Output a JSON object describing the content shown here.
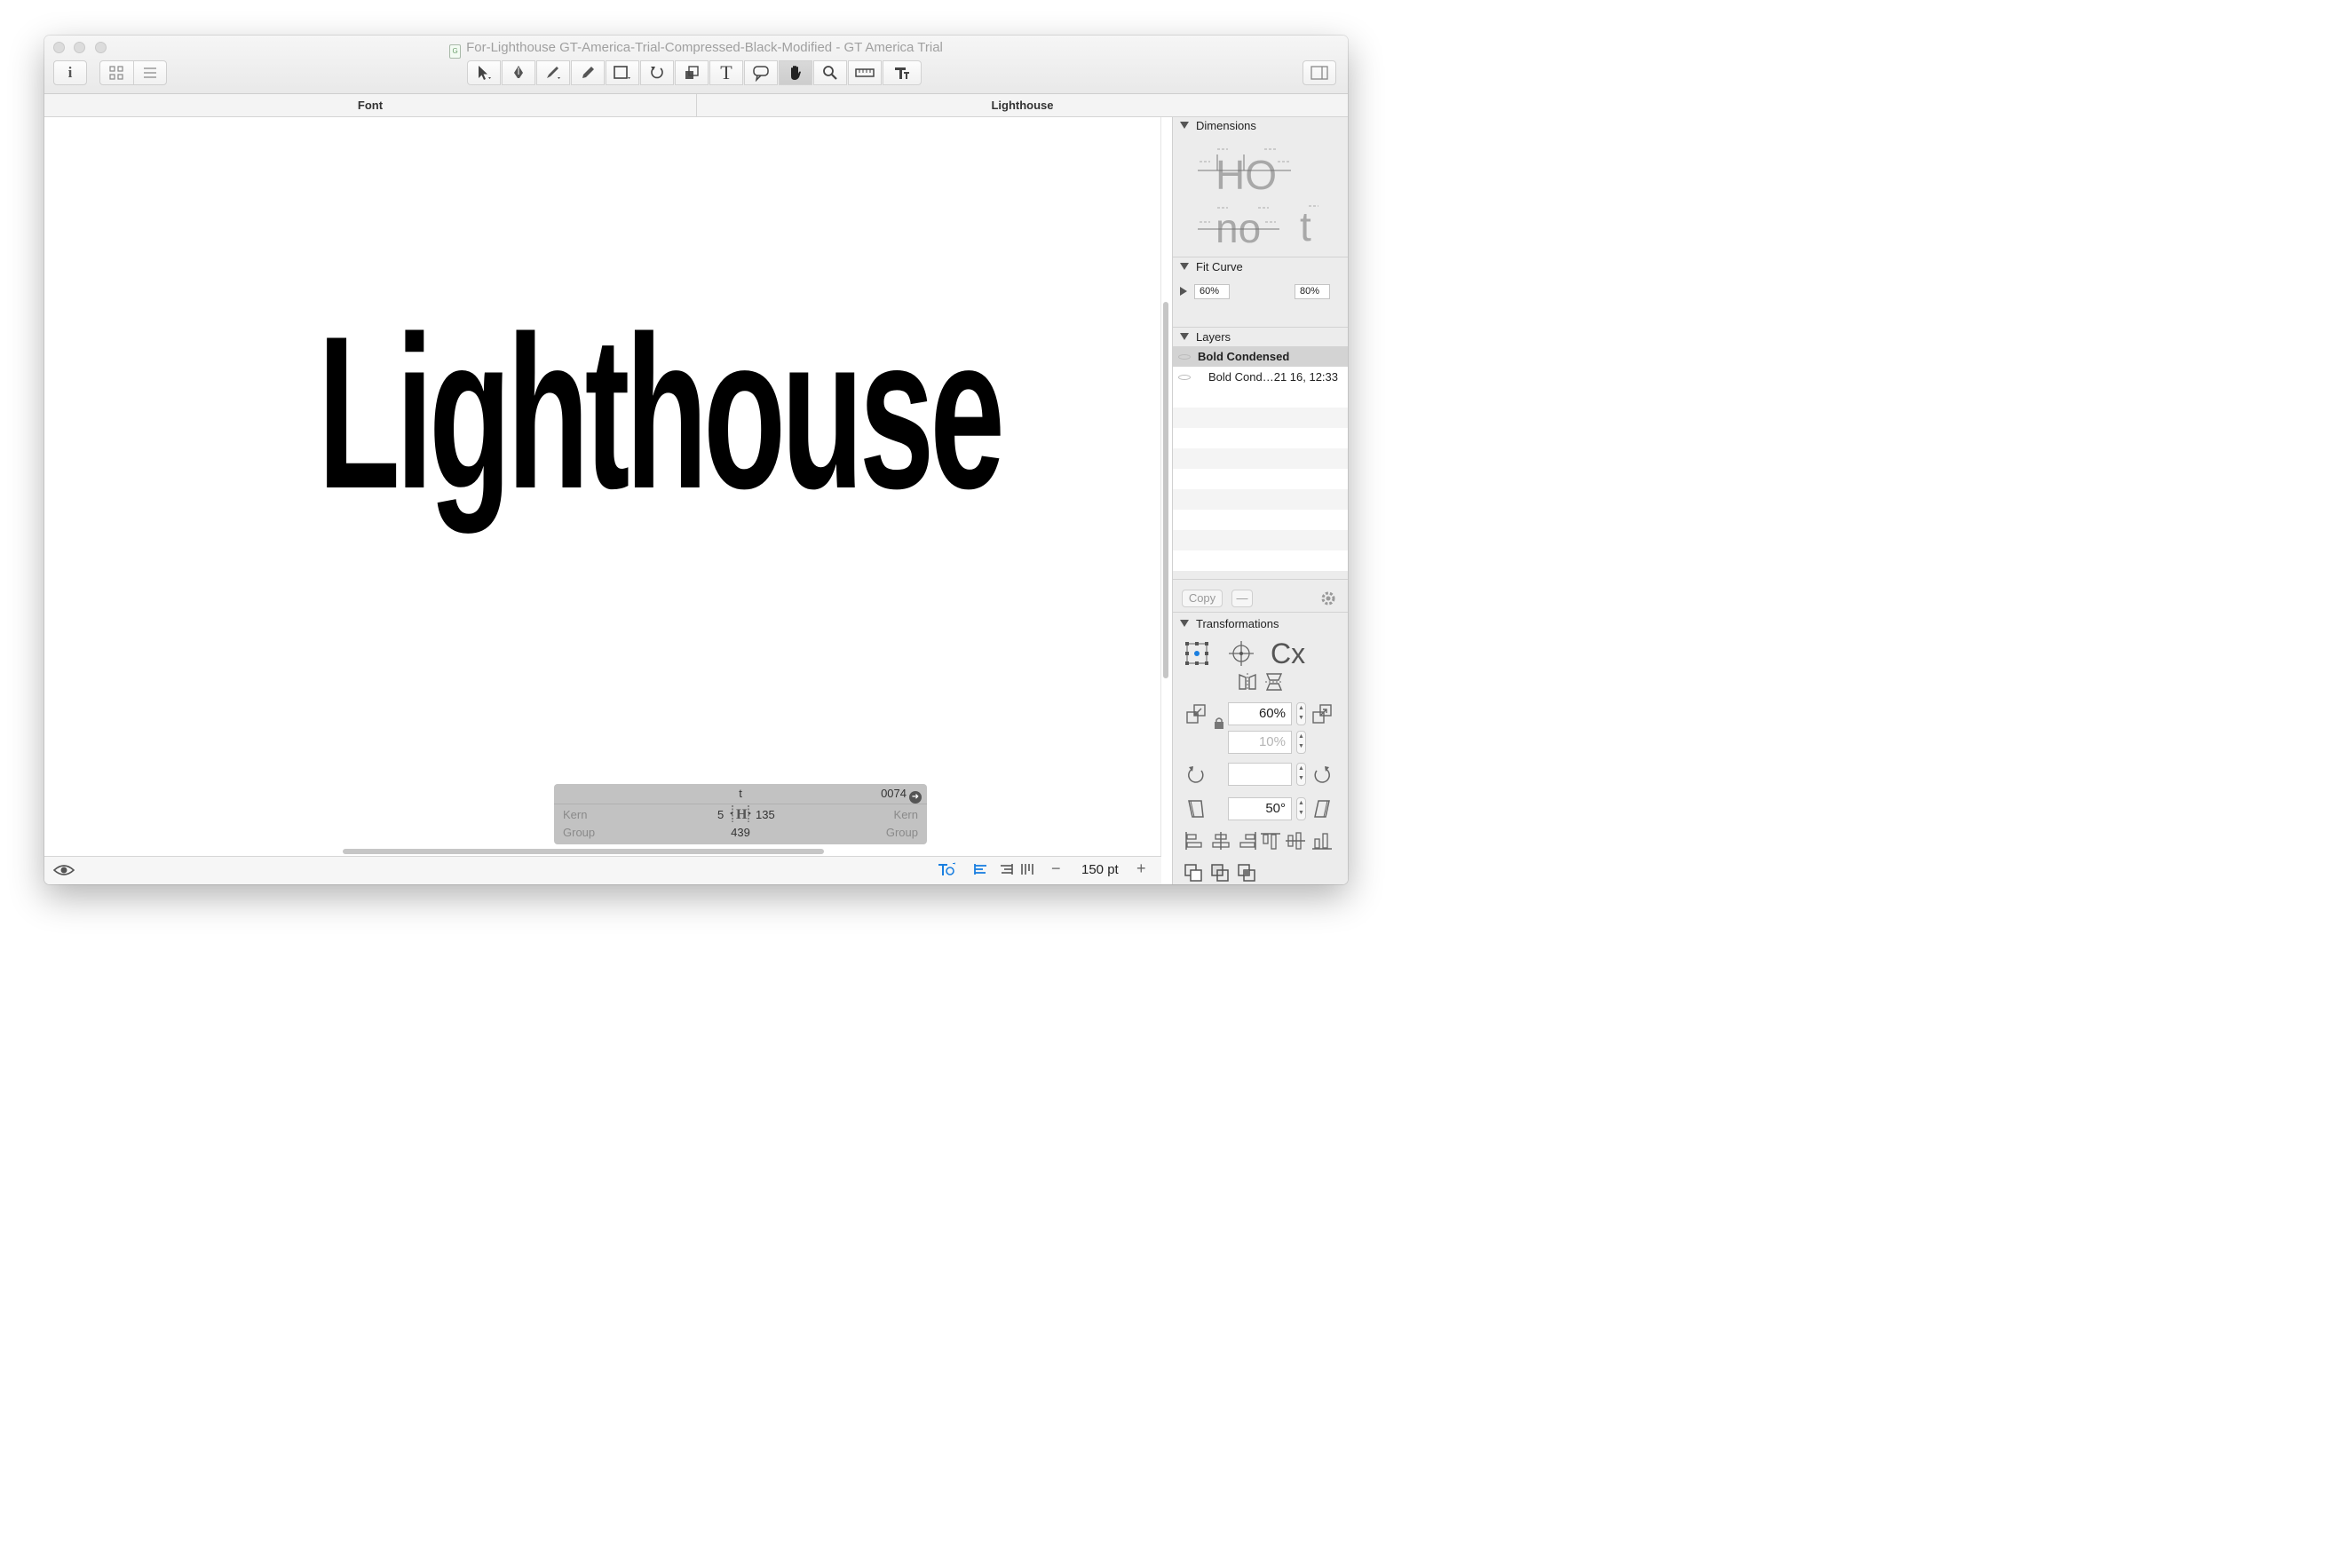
{
  "window": {
    "title": "For-Lighthouse GT-America-Trial-Compressed-Black-Modified - GT America Trial",
    "doc_icon_glyph": "G"
  },
  "tabs": [
    "Font",
    "Lighthouse"
  ],
  "canvas": {
    "specimen_text": "Lighthouse"
  },
  "kern_panel": {
    "glyph": "t",
    "unicode": "0074",
    "left_kern_label": "Kern",
    "left_group_label": "Group",
    "right_kern_label": "Kern",
    "right_group_label": "Group",
    "lsb": "5",
    "rsb": "135",
    "width": "439"
  },
  "bottom_bar": {
    "font_size": "150 pt",
    "minus": "−",
    "plus": "+"
  },
  "sidebar": {
    "dimensions": {
      "label": "Dimensions",
      "glyph_row1": "HO",
      "glyph_row2": "no",
      "glyph_row2b": "t"
    },
    "fit_curve": {
      "label": "Fit Curve",
      "min": "60%",
      "max": "80%"
    },
    "layers": {
      "label": "Layers",
      "items": [
        {
          "name": "Bold Condensed",
          "bold": true
        },
        {
          "name": "Bold Cond…21 16, 12:33",
          "bold": false
        }
      ],
      "copy_label": "Copy",
      "remove_label": "—"
    },
    "transformations": {
      "label": "Transformations",
      "scale_value": "60%",
      "scale_y_value": "10%",
      "rotate_value": "",
      "slant_value": "50°",
      "cx_label": "Cx"
    }
  },
  "colors": {
    "accent": "#1a7fe0",
    "panel_gray": "#c2c2c2",
    "sidebar_bg": "#ececec"
  }
}
